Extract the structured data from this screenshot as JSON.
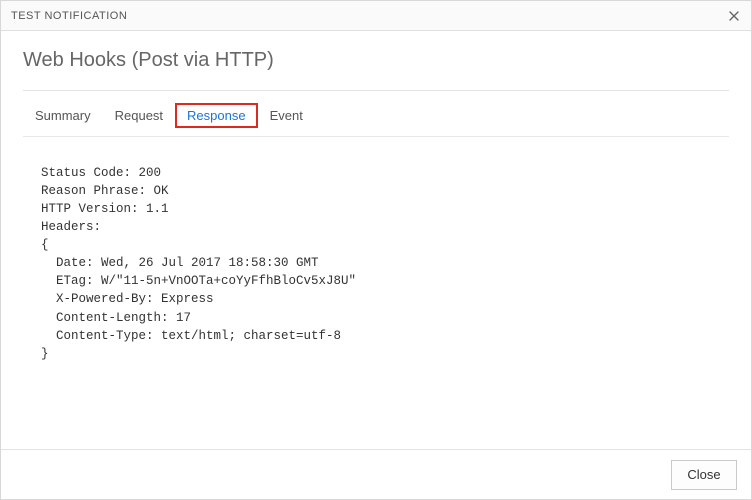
{
  "window": {
    "title": "TEST NOTIFICATION",
    "close_icon": "×"
  },
  "header": {
    "title": "Web Hooks (Post via HTTP)"
  },
  "tabs": [
    {
      "label": "Summary",
      "active": false
    },
    {
      "label": "Request",
      "active": false
    },
    {
      "label": "Response",
      "active": true
    },
    {
      "label": "Event",
      "active": false
    }
  ],
  "response": {
    "status_code": "200",
    "reason_phrase": "OK",
    "http_version": "1.1",
    "headers": {
      "Date": "Wed, 26 Jul 2017 18:58:30 GMT",
      "ETag": "W/\"11-5n+VnOOTa+coYyFfhBloCv5xJ8U\"",
      "X-Powered-By": "Express",
      "Content-Length": "17",
      "Content-Type": "text/html; charset=utf-8"
    }
  },
  "footer": {
    "close_label": "Close"
  }
}
